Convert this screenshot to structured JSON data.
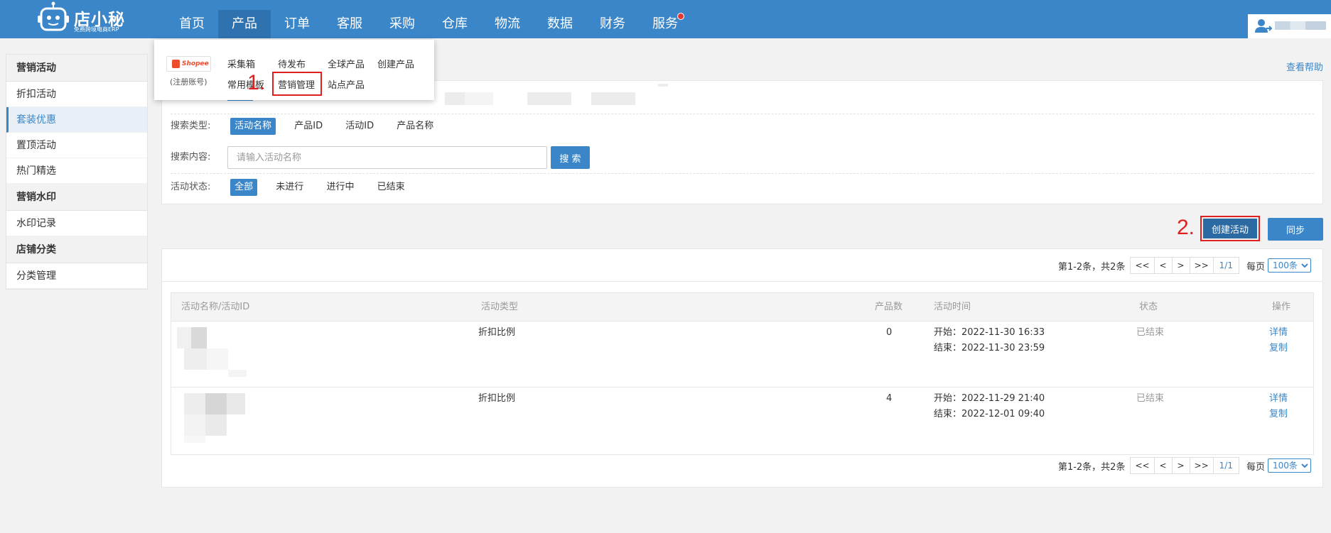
{
  "brand": {
    "name": "店小秘",
    "tagline": "免费跨境电商ERP"
  },
  "nav": {
    "items": [
      {
        "label": "首页"
      },
      {
        "label": "产品"
      },
      {
        "label": "订单"
      },
      {
        "label": "客服"
      },
      {
        "label": "采购"
      },
      {
        "label": "仓库"
      },
      {
        "label": "物流"
      },
      {
        "label": "数据"
      },
      {
        "label": "财务"
      },
      {
        "label": "服务"
      }
    ],
    "active_index": 1
  },
  "dropdown": {
    "platform": "Shopee",
    "platform_note": "(注册账号)",
    "links": [
      {
        "label": "采集箱"
      },
      {
        "label": "待发布"
      },
      {
        "label": "全球产品"
      },
      {
        "label": "创建产品"
      },
      {
        "label": "常用模板"
      },
      {
        "label": "营销管理"
      },
      {
        "label": "站点产品"
      }
    ],
    "step_1": "1.",
    "step_2": "2."
  },
  "sidebar": {
    "groups": [
      {
        "title": "营销活动",
        "items": [
          {
            "label": "折扣活动"
          },
          {
            "label": "套装优惠"
          },
          {
            "label": "置顶活动"
          },
          {
            "label": "热门精选"
          }
        ]
      },
      {
        "title": "营销水印",
        "items": [
          {
            "label": "水印记录"
          }
        ]
      },
      {
        "title": "店铺分类",
        "items": [
          {
            "label": "分类管理"
          }
        ]
      }
    ],
    "active_label": "套装优惠"
  },
  "help": {
    "label": "查看帮助"
  },
  "filters": {
    "search_type_label": "搜索类型:",
    "search_type_options": [
      {
        "label": "活动名称"
      },
      {
        "label": "产品ID"
      },
      {
        "label": "活动ID"
      },
      {
        "label": "产品名称"
      }
    ],
    "search_content_label": "搜索内容:",
    "search_placeholder": "请输入活动名称",
    "search_button": "搜 索",
    "status_label": "活动状态:",
    "status_options": [
      {
        "label": "全部"
      },
      {
        "label": "未进行"
      },
      {
        "label": "进行中"
      },
      {
        "label": "已结束"
      }
    ]
  },
  "actions": {
    "create_label": "创建活动",
    "sync_label": "同步"
  },
  "pager": {
    "summary": "第1-2条，共2条",
    "first": "<<",
    "prev": "<",
    "next": ">",
    "last": ">>",
    "current": "1/1",
    "per_page_label": "每页",
    "per_page_value": "100条"
  },
  "table": {
    "headers": {
      "name": "活动名称/活动ID",
      "type": "活动类型",
      "count": "产品数",
      "time": "活动时间",
      "status": "状态",
      "ops": "操作"
    },
    "rows": [
      {
        "type": "折扣比例",
        "count": "0",
        "start": "开始：2022-11-30 16:33",
        "end": "结束：2022-11-30 23:59",
        "status": "已结束",
        "op_detail": "详情",
        "op_copy": "复制"
      },
      {
        "type": "折扣比例",
        "count": "4",
        "start": "开始：2022-11-29 21:40",
        "end": "结束：2022-12-01 09:40",
        "status": "已结束",
        "op_detail": "详情",
        "op_copy": "复制"
      }
    ]
  },
  "colors": {
    "primary": "#3a86c8",
    "primary_dark": "#2c6aa3",
    "highlight": "#e02020",
    "shopee": "#ee4d2d"
  }
}
